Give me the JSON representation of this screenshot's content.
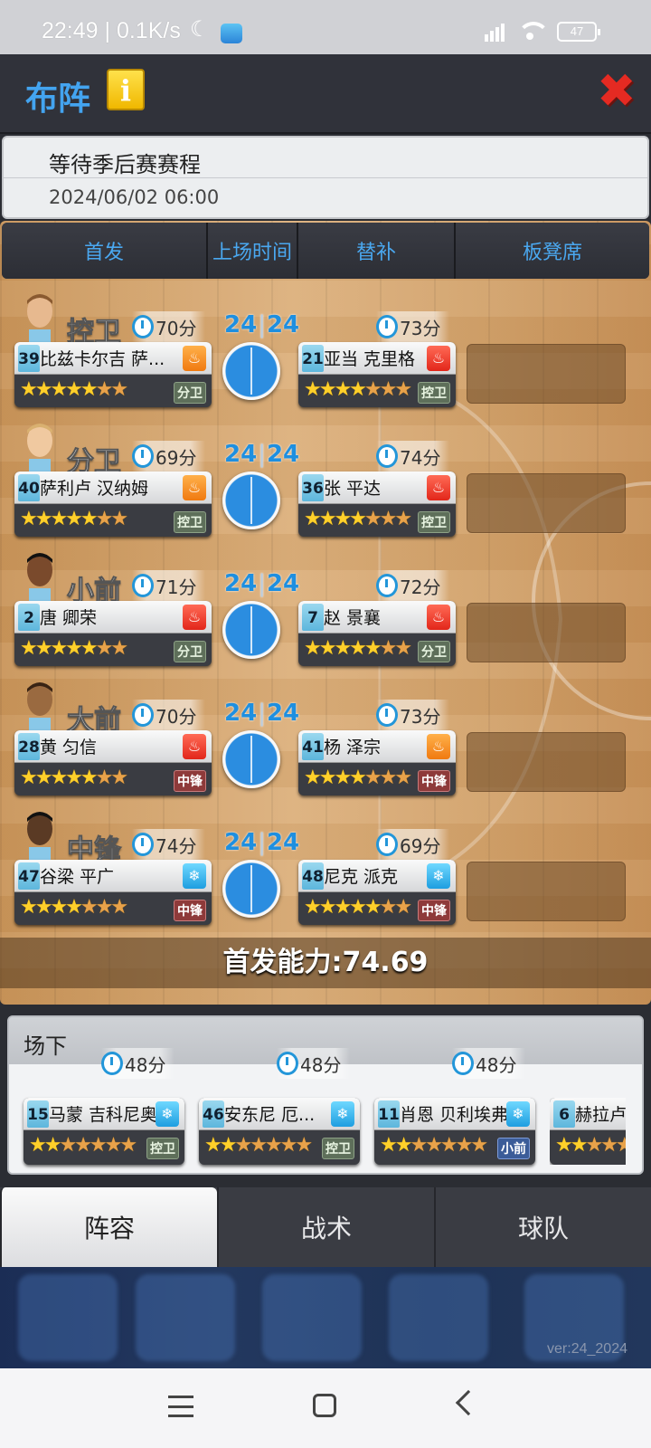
{
  "status_bar": {
    "time": "22:49",
    "speed": "0.1K/s",
    "signal": "HD",
    "battery": "47"
  },
  "header": {
    "title": "布阵",
    "info_icon": "i",
    "close_icon": "✖"
  },
  "schedule": {
    "status": "等待季后赛赛程",
    "datetime": "2024/06/02 06:00"
  },
  "tabs": [
    "首发",
    "上场时间",
    "替补",
    "板凳席"
  ],
  "score_label": {
    "left": "24",
    "right": "24"
  },
  "positions": [
    {
      "pos": "控卫",
      "starter": {
        "minutes": "70分",
        "number": "39",
        "name": "比兹卡尔吉 萨...",
        "form": "fire-o",
        "stars": 5,
        "pos_badge": "分卫",
        "badge_color": "green"
      },
      "sub": {
        "minutes": "73分",
        "number": "21",
        "name": "亚当 克里格",
        "form": "fire-r",
        "stars": 4,
        "pos_badge": "控卫",
        "badge_color": "green"
      }
    },
    {
      "pos": "分卫",
      "starter": {
        "minutes": "69分",
        "number": "40",
        "name": "萨利卢 汉纳姆",
        "form": "fire-o",
        "stars": 5,
        "pos_badge": "控卫",
        "badge_color": "green"
      },
      "sub": {
        "minutes": "74分",
        "number": "36",
        "name": "张 平达",
        "form": "fire-r",
        "stars": 4,
        "pos_badge": "控卫",
        "badge_color": "green"
      }
    },
    {
      "pos": "小前",
      "starter": {
        "minutes": "71分",
        "number": "2",
        "name": "唐 卿荣",
        "form": "fire-r",
        "stars": 5,
        "pos_badge": "分卫",
        "badge_color": "green"
      },
      "sub": {
        "minutes": "72分",
        "number": "7",
        "name": "赵 景襄",
        "form": "fire-r",
        "stars": 5,
        "pos_badge": "分卫",
        "badge_color": "green"
      }
    },
    {
      "pos": "大前",
      "starter": {
        "minutes": "70分",
        "number": "28",
        "name": "黄 匀信",
        "form": "fire-r",
        "stars": 5,
        "pos_badge": "中锋",
        "badge_color": "red"
      },
      "sub": {
        "minutes": "73分",
        "number": "41",
        "name": "杨 泽宗",
        "form": "fire-o",
        "stars": 4,
        "pos_badge": "中锋",
        "badge_color": "red"
      }
    },
    {
      "pos": "中锋",
      "starter": {
        "minutes": "74分",
        "number": "47",
        "name": "谷梁 平广",
        "form": "ice",
        "stars": 4,
        "pos_badge": "中锋",
        "badge_color": "red"
      },
      "sub": {
        "minutes": "69分",
        "number": "48",
        "name": "尼克 派克",
        "form": "ice",
        "stars": 5,
        "pos_badge": "中锋",
        "badge_color": "red"
      }
    }
  ],
  "ability": "首发能力:74.69",
  "offcourt": {
    "title": "场下",
    "players": [
      {
        "minutes": "48分",
        "number": "15",
        "name": "马蒙 吉科尼奥",
        "form": "ice",
        "stars": 2,
        "pos_badge": "控卫",
        "badge_color": "green"
      },
      {
        "minutes": "48分",
        "number": "46",
        "name": "安东尼 厄...",
        "form": "ice",
        "stars": 2,
        "pos_badge": "控卫",
        "badge_color": "green"
      },
      {
        "minutes": "48分",
        "number": "11",
        "name": "肖恩 贝利埃弗",
        "form": "ice",
        "stars": 2,
        "pos_badge": "小前",
        "badge_color": "blue"
      },
      {
        "minutes": "",
        "number": "6",
        "name": "赫拉卢",
        "form": "",
        "stars": 2,
        "pos_badge": "",
        "badge_color": "green"
      }
    ]
  },
  "bottom_tabs": [
    "阵容",
    "战术",
    "球队"
  ],
  "version": "ver:24_2024",
  "colors": {
    "accent": "#43a4f0",
    "close": "#e52a22",
    "court": "#d2a26b"
  }
}
